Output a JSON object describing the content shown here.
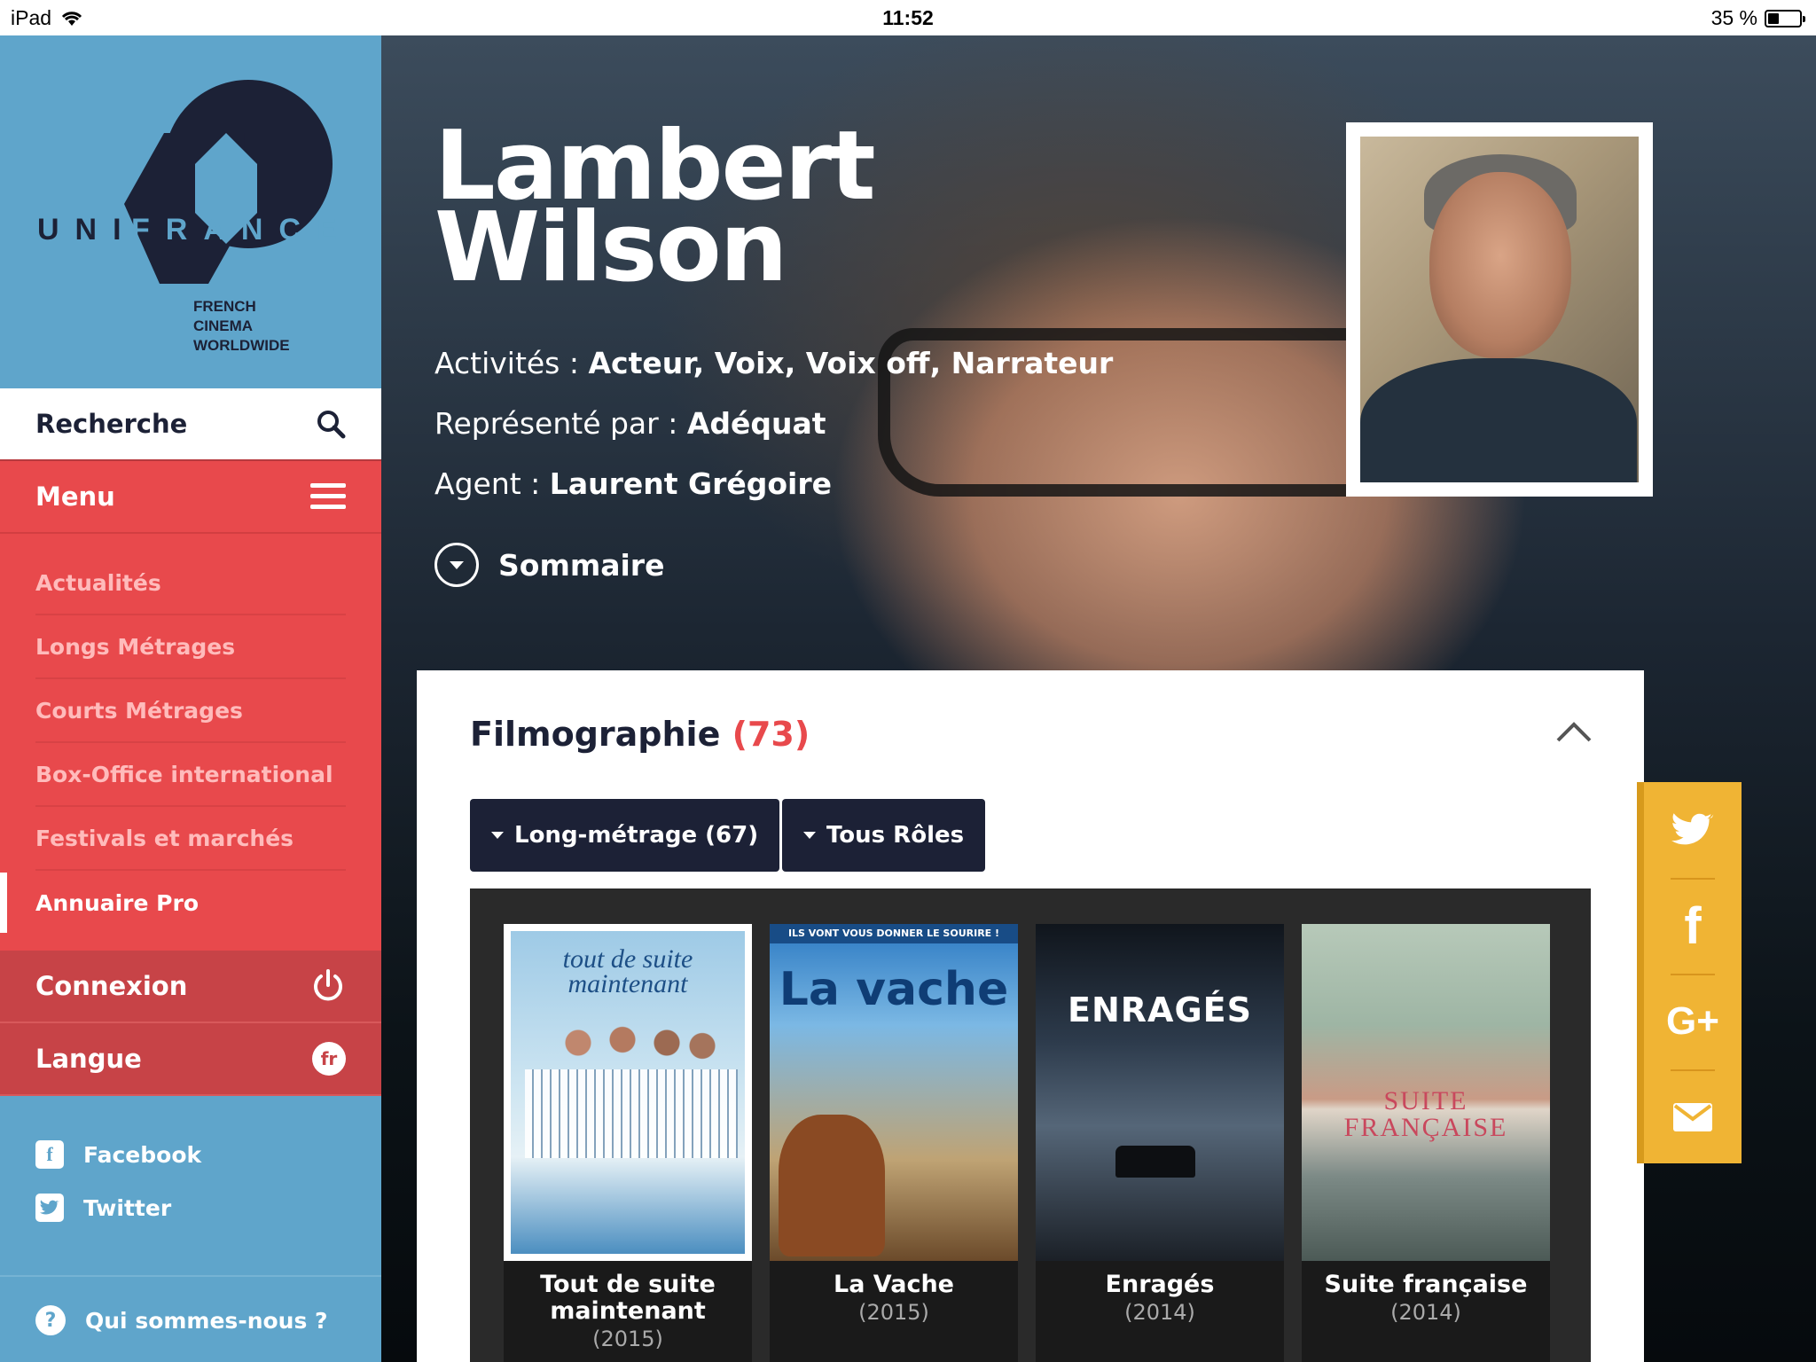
{
  "status_bar": {
    "device": "iPad",
    "time": "11:52",
    "battery": "35 %",
    "battery_level": 0.35
  },
  "brand": {
    "logo_text": "UNIFRANCE",
    "tagline": [
      "FRENCH",
      "CINEMA",
      "WORLDWIDE"
    ],
    "colors": {
      "sidebar_blue": "#5fa5cb",
      "menu_red": "#e8494c",
      "navy": "#1c2136",
      "share_yellow": "#f0b434"
    }
  },
  "sidebar": {
    "search_label": "Recherche",
    "menu_label": "Menu",
    "items": [
      {
        "label": "Actualités"
      },
      {
        "label": "Longs Métrages"
      },
      {
        "label": "Courts Métrages"
      },
      {
        "label": "Box-Office international"
      },
      {
        "label": "Festivals et marchés"
      },
      {
        "label": "Annuaire Pro",
        "active": true
      }
    ],
    "login_label": "Connexion",
    "language_label": "Langue",
    "language_code": "fr",
    "social": [
      {
        "label": "Facebook",
        "icon": "facebook-icon"
      },
      {
        "label": "Twitter",
        "icon": "twitter-icon"
      }
    ],
    "about_label": "Qui sommes-nous ?"
  },
  "profile": {
    "first_name": "Lambert",
    "last_name": "Wilson",
    "activities_label": "Activités :",
    "activities": "Acteur, Voix, Voix off, Narrateur",
    "represented_label": "Représenté par :",
    "represented": "Adéquat",
    "agent_label": "Agent :",
    "agent": "Laurent Grégoire",
    "summary_label": "Sommaire"
  },
  "filmography": {
    "title": "Filmographie",
    "count": "(73)",
    "filter_type": "Long-métrage (67)",
    "filter_role": "Tous Rôles",
    "films": [
      {
        "title": "Tout de suite maintenant",
        "year": "(2015)",
        "poster_text": "tout de suite maintenant"
      },
      {
        "title": "La Vache",
        "year": "(2015)",
        "poster_tagline": "ILS VONT VOUS DONNER LE SOURIRE !",
        "poster_text": "La vache"
      },
      {
        "title": "Enragés",
        "year": "(2014)",
        "poster_text": "ENRAGÉS"
      },
      {
        "title": "Suite française",
        "year": "(2014)",
        "poster_text": "SUITE FRANÇAISE"
      }
    ]
  },
  "share": [
    {
      "icon": "twitter-icon"
    },
    {
      "icon": "facebook-icon"
    },
    {
      "icon": "google-plus-icon"
    },
    {
      "icon": "mail-icon"
    }
  ]
}
